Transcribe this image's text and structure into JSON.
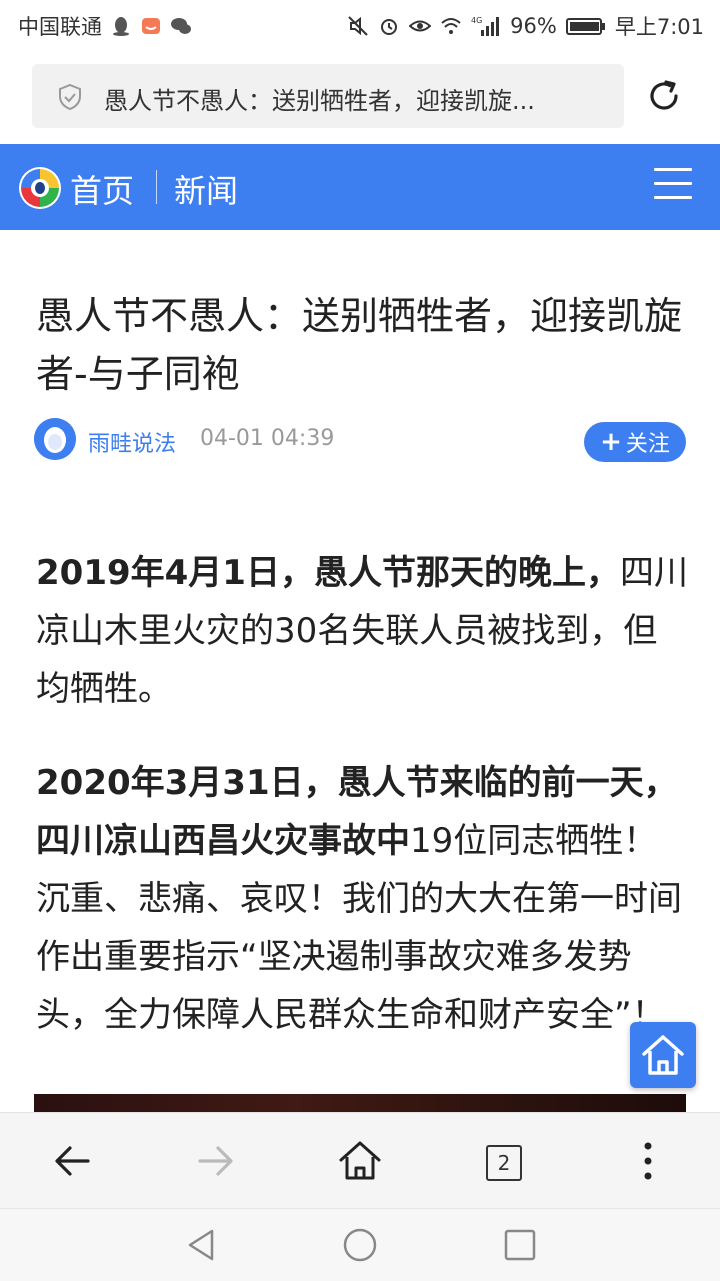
{
  "status_bar": {
    "carrier": "中国联通",
    "battery": "96%",
    "time": "早上7:01",
    "network": "4G"
  },
  "url_bar": {
    "text": "愚人节不愚人：送别牺牲者，迎接凯旋..."
  },
  "nav": {
    "home": "首页",
    "news": "新闻"
  },
  "article": {
    "title": "愚人节不愚人：送别牺牲者，迎接凯旋者-与子同袍",
    "author": "雨畦说法",
    "time": "04-01 04:39",
    "follow": "关注",
    "p1_bold": "2019年4月1日，愚人节那天的晚上，",
    "p1_text": "四川凉山木里火灾的30名失联人员被找到，但均牺牲。",
    "p2_bold": "2020年3月31日，愚人节来临的前一天，四川凉山西昌火灾事故中",
    "p2_text": "19位同志牺牲！沉重、悲痛、哀叹！我们的大大在第一时间作出重要指示“坚决遏制事故灾难多发势头，全力保障人民群众生命和财产安全”！"
  },
  "toolbar": {
    "tab_count": "2"
  },
  "colors": {
    "accent": "#3d7ff0"
  }
}
